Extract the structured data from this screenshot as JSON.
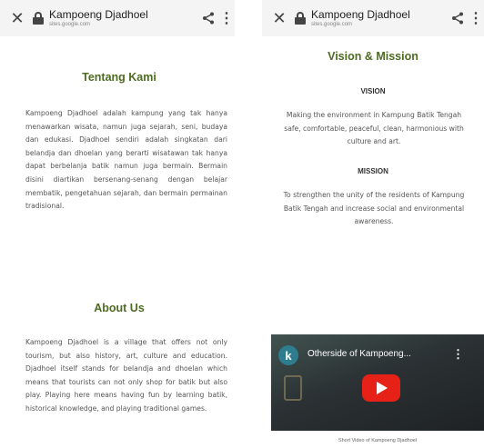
{
  "left_panel": {
    "topbar": {
      "title": "Kampoeng Djadhoel",
      "url": "sites.google.com",
      "icons": [
        "close-icon",
        "lock-icon",
        "share-icon",
        "more-vert-icon"
      ]
    },
    "tentang": {
      "heading": "Tentang Kami",
      "text": "Kampoeng Djadhoel adalah kampung yang tak hanya menawarkan wisata, namun juga sejarah, seni, budaya dan edukasi. Djadhoel sendiri adalah singkatan dari belandja dan dhoelan yang berarti wisatawan tak hanya dapat berbelanja batik namun juga bermain. Bermain disini diartikan bersenang-senang dengan belajar membatik, pengetahuan sejarah, dan bermain permainan tradisional."
    },
    "about": {
      "heading": "About Us",
      "text": "Kampoeng Djadhoel is a village that offers not only tourism, but also history, art, culture and education. Djadhoel itself stands for belandja and dhoelan which means that tourists can not only shop for batik but also play. Playing here means having fun by learning batik, historical knowledge, and playing traditional games."
    }
  },
  "right_panel": {
    "topbar": {
      "title": "Kampoeng Djadhoel",
      "url": "sites.google.com",
      "icons": [
        "close-icon",
        "lock-icon",
        "share-icon",
        "more-vert-icon"
      ]
    },
    "heading": "Vision & Mission",
    "vision_label": "VISION",
    "vision_text": "Making the environment in Kampung Batik Tengah safe, comfortable, peaceful, clean, harmonious with culture and art.",
    "mission_label": "MISSION",
    "mission_text": "To strengthen the unity of the residents of Kampung Batik Tengah and increase social and environmental awareness.",
    "video": {
      "channel_initial": "k",
      "title": "Otherside of Kampoeng...",
      "caption": "Short Video of Kampoeng Djadhoel"
    }
  },
  "colors": {
    "heading_green": "#4d6b21",
    "topbar_bg": "#f4f4f4",
    "youtube_red": "#e62117"
  }
}
